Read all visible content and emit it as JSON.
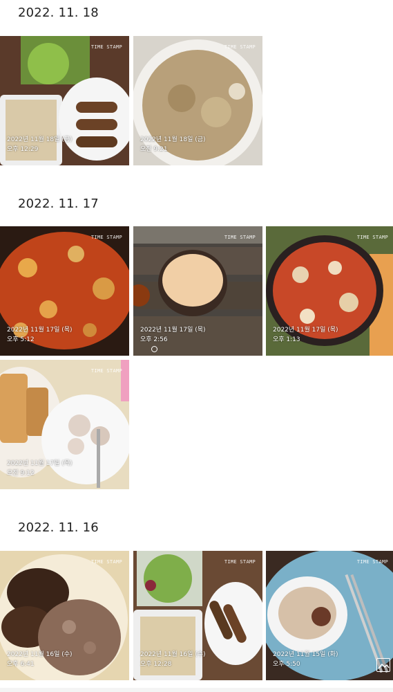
{
  "groups": [
    {
      "date": "2022. 11. 18",
      "photos": [
        {
          "date_line": "2022년 11월 18일 (금)",
          "time_line": "오후 12:29",
          "stamp": "TIME STAMP"
        },
        {
          "date_line": "2022년 11월 18일 (금)",
          "time_line": "오전 9:21",
          "stamp": "TIME STAMP"
        }
      ]
    },
    {
      "date": "2022. 11. 17",
      "photos": [
        {
          "date_line": "2022년 11월 17일 (목)",
          "time_line": "오후 5:12",
          "stamp": "TIME STAMP"
        },
        {
          "date_line": "2022년 11월 17일 (목)",
          "time_line": "오후 2:56",
          "stamp": "TIME STAMP"
        },
        {
          "date_line": "2022년 11월 17일 (목)",
          "time_line": "오후 1:13",
          "stamp": "TIME STAMP"
        },
        {
          "date_line": "2022년 11월 17일 (목)",
          "time_line": "오전 9:12",
          "stamp": "TIME STAMP"
        }
      ]
    },
    {
      "date": "2022. 11. 16",
      "photos": [
        {
          "date_line": "2022년 11월 16일 (수)",
          "time_line": "오후 6:41",
          "stamp": "TIME STAMP"
        },
        {
          "date_line": "2022년 11월 16일 (수)",
          "time_line": "오후 12:28",
          "stamp": "TIME STAMP"
        },
        {
          "date_line": "2022년 11월 15일 (화)",
          "time_line": "오후 5:50",
          "stamp": "TIME STAMP"
        }
      ]
    }
  ]
}
